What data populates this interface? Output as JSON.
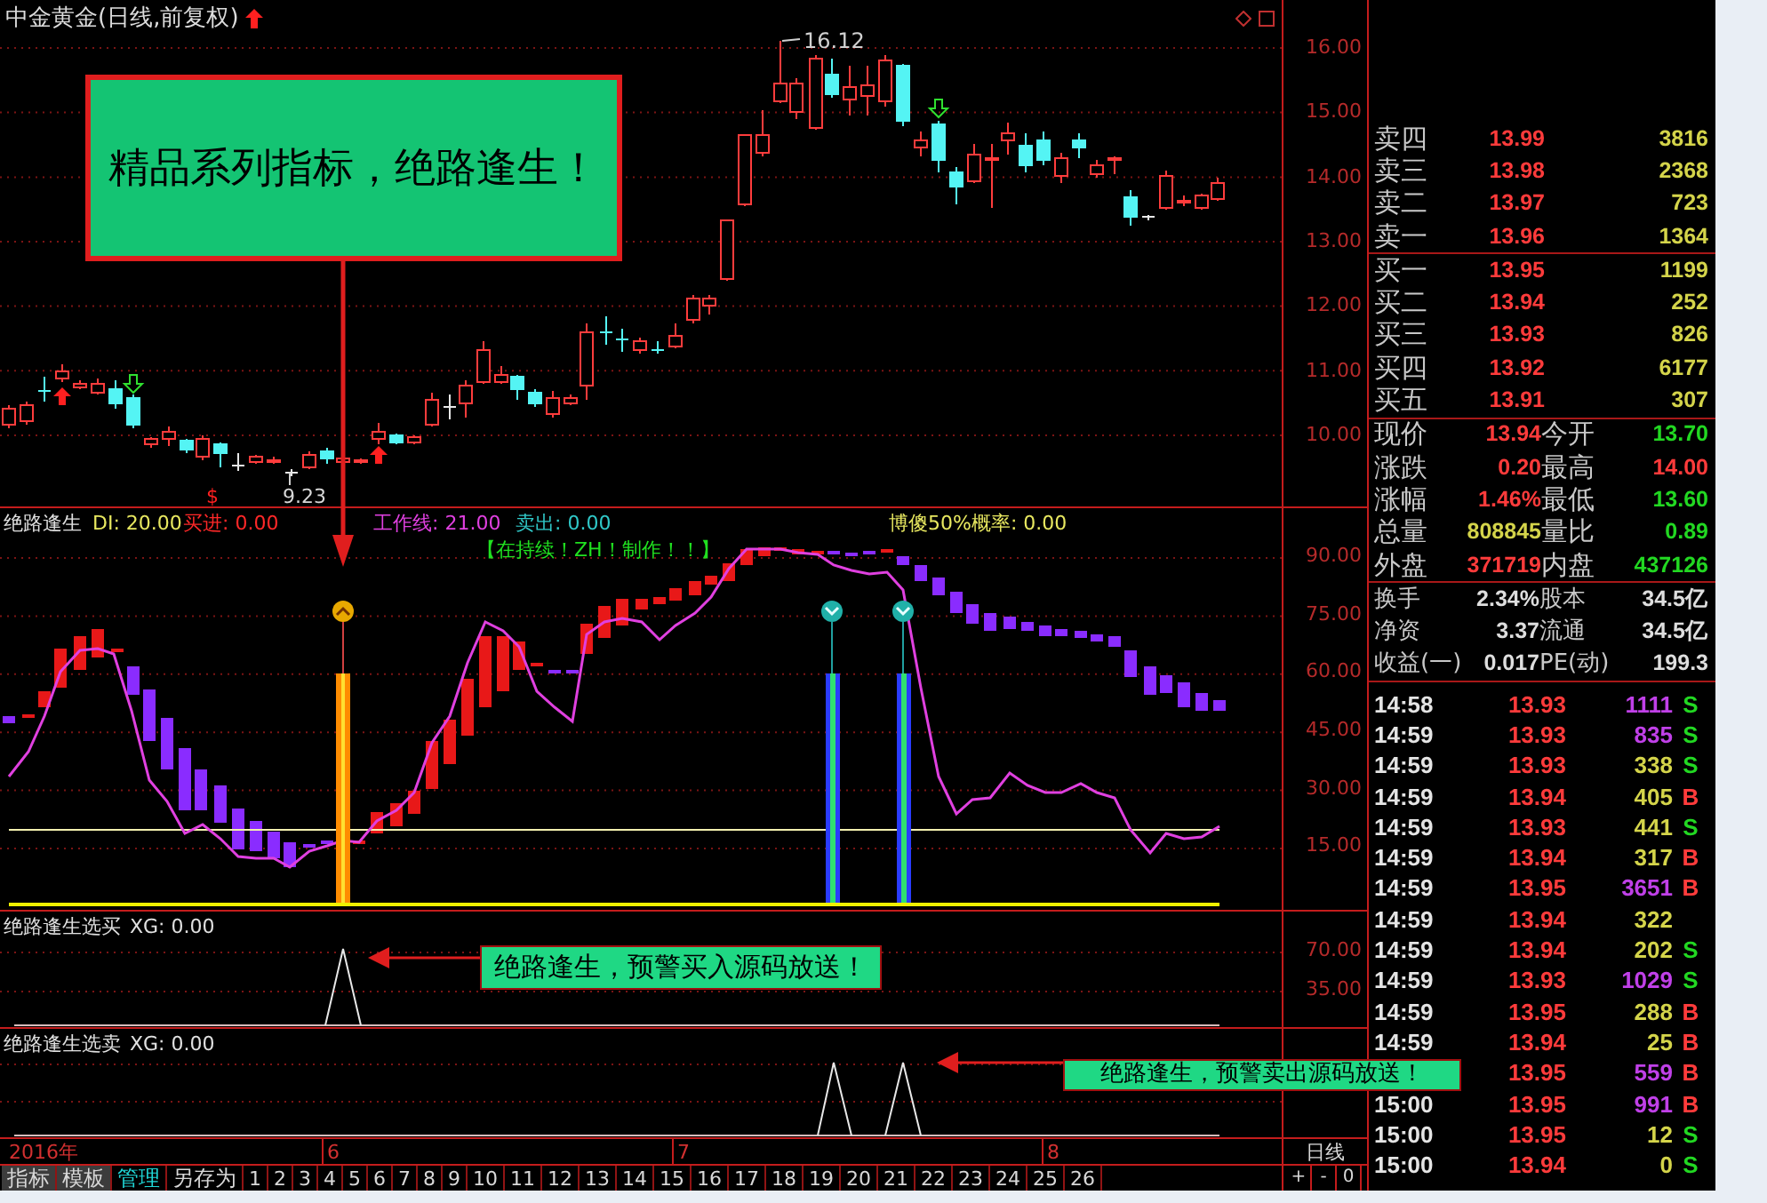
{
  "title": "中金黄金(日线,前复权)",
  "price_chart": {
    "high_label": "16.12",
    "low_label": "9.23",
    "mark": "$",
    "axis": [
      "16.00",
      "15.00",
      "14.00",
      "13.00",
      "12.00",
      "11.00",
      "10.00"
    ]
  },
  "callouts": [
    {
      "kind": "main",
      "text": "精品系列指标，绝路逢生！"
    },
    {
      "kind": "buy",
      "text": "绝路逢生，预警买入源码放送！"
    },
    {
      "kind": "sell",
      "text": "绝路逢生，预警卖出源码放送！"
    }
  ],
  "indicator": {
    "legend": [
      {
        "text": "绝路逢生",
        "color": "#e0e0e0"
      },
      {
        "text": "DI: 20.00",
        "color": "#e8e860"
      },
      {
        "text": "买进: 0.00",
        "color": "#ff2828"
      },
      {
        "text": "工作线: 21.00",
        "color": "#e040e0"
      },
      {
        "text": "卖出: 0.00",
        "color": "#30c8c8"
      },
      {
        "text": "博傻50%概率: 0.00",
        "color": "#e8e860"
      }
    ],
    "status": "【在持续！ZH！制作！！】",
    "axis": [
      "90.00",
      "75.00",
      "60.00",
      "45.00",
      "30.00",
      "15.00"
    ]
  },
  "buy_pane": {
    "title": "绝路逢生选买",
    "reading": "XG: 0.00",
    "axis": [
      "70.00",
      "35.00"
    ]
  },
  "sell_pane": {
    "title": "绝路逢生选卖",
    "reading": "XG: 0.00"
  },
  "date_axis": [
    "2016年",
    "6",
    "7",
    "8"
  ],
  "period": "日线",
  "toolbar": [
    {
      "label": "指标",
      "kind": "button",
      "selected": false
    },
    {
      "label": "模板",
      "kind": "button",
      "selected": false
    },
    {
      "label": "管理",
      "kind": "text",
      "selected": true
    },
    {
      "label": "另存为",
      "kind": "text",
      "selected": false
    }
  ],
  "page_tabs": [
    {
      "label": "1",
      "selected": false
    },
    {
      "label": "2",
      "selected": false
    },
    {
      "label": "3",
      "selected": false
    },
    {
      "label": "4",
      "selected": false
    },
    {
      "label": "5",
      "selected": false
    },
    {
      "label": "6",
      "selected": false
    },
    {
      "label": "7",
      "selected": false
    },
    {
      "label": "8",
      "selected": false
    },
    {
      "label": "9",
      "selected": false
    },
    {
      "label": "10",
      "selected": false
    },
    {
      "label": "11",
      "selected": false
    },
    {
      "label": "12",
      "selected": false
    },
    {
      "label": "13",
      "selected": false
    },
    {
      "label": "14",
      "selected": false
    },
    {
      "label": "15",
      "selected": false
    },
    {
      "label": "16",
      "selected": false
    },
    {
      "label": "17",
      "selected": false
    },
    {
      "label": "18",
      "selected": false
    },
    {
      "label": "19",
      "selected": false
    },
    {
      "label": "20",
      "selected": false
    },
    {
      "label": "21",
      "selected": false
    },
    {
      "label": "22",
      "selected": false
    },
    {
      "label": "23",
      "selected": false
    },
    {
      "label": "24",
      "selected": false
    },
    {
      "label": "25",
      "selected": false
    },
    {
      "label": "26",
      "selected": false
    }
  ],
  "zoom_buttons": [
    "+",
    "-",
    "0"
  ],
  "order_book": {
    "asks": [
      {
        "label": "卖四",
        "price": "13.99",
        "volume": "3816"
      },
      {
        "label": "卖三",
        "price": "13.98",
        "volume": "2368"
      },
      {
        "label": "卖二",
        "price": "13.97",
        "volume": "723"
      },
      {
        "label": "卖一",
        "price": "13.96",
        "volume": "1364"
      }
    ],
    "bids": [
      {
        "label": "买一",
        "price": "13.95",
        "volume": "1199"
      },
      {
        "label": "买二",
        "price": "13.94",
        "volume": "252"
      },
      {
        "label": "买三",
        "price": "13.93",
        "volume": "826"
      },
      {
        "label": "买四",
        "price": "13.92",
        "volume": "6177"
      },
      {
        "label": "买五",
        "price": "13.91",
        "volume": "307"
      }
    ]
  },
  "quote": [
    {
      "label": "现价",
      "value": "13.94",
      "color": "#ff3b3b"
    },
    {
      "label": "今开",
      "value": "13.70",
      "color": "#22d822"
    },
    {
      "label": "涨跌",
      "value": "0.20",
      "color": "#ff3b3b"
    },
    {
      "label": "最高",
      "value": "14.00",
      "color": "#ff3b3b"
    },
    {
      "label": "涨幅",
      "value": "1.46%",
      "color": "#ff3b3b"
    },
    {
      "label": "最低",
      "value": "13.60",
      "color": "#22d822"
    },
    {
      "label": "总量",
      "value": "808845",
      "color": "#d4d44a"
    },
    {
      "label": "量比",
      "value": "0.89",
      "color": "#22d822"
    },
    {
      "label": "外盘",
      "value": "371719",
      "color": "#ff3b3b"
    },
    {
      "label": "内盘",
      "value": "437126",
      "color": "#22d822"
    }
  ],
  "fundamentals": [
    {
      "label": "换手",
      "value": "2.34%"
    },
    {
      "label": "股本",
      "value": "34.5亿"
    },
    {
      "label": "净资",
      "value": "3.37"
    },
    {
      "label": "流通",
      "value": "34.5亿"
    },
    {
      "label": "收益(一)",
      "value": "0.017"
    },
    {
      "label": "PE(动)",
      "value": "199.3"
    }
  ],
  "trades": [
    {
      "time": "14:58",
      "price": "13.93",
      "volume": {
        "text": "1111",
        "color": "#c040e8"
      },
      "side": {
        "text": "S",
        "color": "#22d822"
      }
    },
    {
      "time": "14:59",
      "price": "13.93",
      "volume": {
        "text": "835",
        "color": "#c040e8"
      },
      "side": {
        "text": "S",
        "color": "#22d822"
      }
    },
    {
      "time": "14:59",
      "price": "13.93",
      "volume": {
        "text": "338",
        "color": "#d4d44a"
      },
      "side": {
        "text": "S",
        "color": "#22d822"
      }
    },
    {
      "time": "14:59",
      "price": "13.94",
      "volume": {
        "text": "405",
        "color": "#d4d44a"
      },
      "side": {
        "text": "B",
        "color": "#ff3b3b"
      }
    },
    {
      "time": "14:59",
      "price": "13.93",
      "volume": {
        "text": "441",
        "color": "#d4d44a"
      },
      "side": {
        "text": "S",
        "color": "#22d822"
      }
    },
    {
      "time": "14:59",
      "price": "13.94",
      "volume": {
        "text": "317",
        "color": "#d4d44a"
      },
      "side": {
        "text": "B",
        "color": "#ff3b3b"
      }
    },
    {
      "time": "14:59",
      "price": "13.95",
      "volume": {
        "text": "3651",
        "color": "#c040e8"
      },
      "side": {
        "text": "B",
        "color": "#ff3b3b"
      }
    },
    {
      "time": "14:59",
      "price": "13.94",
      "volume": {
        "text": "322",
        "color": "#d4d44a"
      }
    },
    {
      "time": "14:59",
      "price": "13.94",
      "volume": {
        "text": "202",
        "color": "#d4d44a"
      },
      "side": {
        "text": "S",
        "color": "#22d822"
      }
    },
    {
      "time": "14:59",
      "price": "13.93",
      "volume": {
        "text": "1029",
        "color": "#c040e8"
      },
      "side": {
        "text": "S",
        "color": "#22d822"
      }
    },
    {
      "time": "14:59",
      "price": "13.95",
      "volume": {
        "text": "288",
        "color": "#d4d44a"
      },
      "side": {
        "text": "B",
        "color": "#ff3b3b"
      }
    },
    {
      "time": "14:59",
      "price": "13.94",
      "volume": {
        "text": "25",
        "color": "#d4d44a"
      },
      "side": {
        "text": "B",
        "color": "#ff3b3b"
      }
    },
    {
      "price": "13.95",
      "volume": {
        "text": "559",
        "color": "#c040e8"
      },
      "side": {
        "text": "B",
        "color": "#ff3b3b"
      }
    },
    {
      "time": "15:00",
      "price": "13.95",
      "volume": {
        "text": "991",
        "color": "#c040e8"
      },
      "side": {
        "text": "B",
        "color": "#ff3b3b"
      }
    },
    {
      "time": "15:00",
      "price": "13.95",
      "volume": {
        "text": "12",
        "color": "#d4d44a"
      },
      "side": {
        "text": "S",
        "color": "#22d822"
      }
    },
    {
      "time": "15:00",
      "price": "13.94",
      "volume": {
        "text": "0",
        "color": "#d4d44a"
      },
      "side": {
        "text": "S",
        "color": "#22d822"
      }
    }
  ]
}
